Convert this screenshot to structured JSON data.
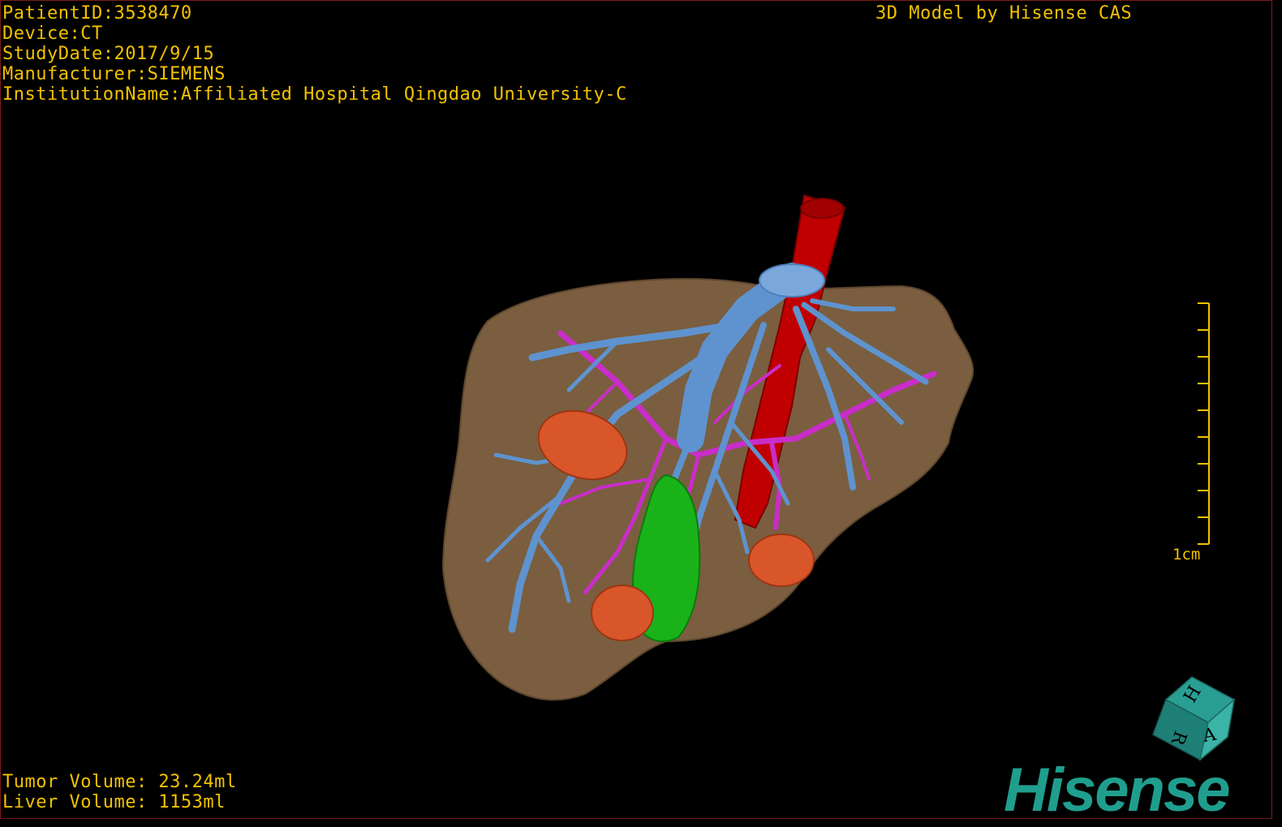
{
  "header": {
    "patient_id": "PatientID:3538470",
    "device": "Device:CT",
    "study_date": "StudyDate:2017/9/15",
    "manufacturer": "Manufacturer:SIEMENS",
    "institution": "InstitutionName:Affiliated Hospital Qingdao University-C",
    "model_credit": "3D Model by Hisense CAS"
  },
  "volumes": {
    "tumor": "Tumor Volume: 23.24ml",
    "liver": "Liver Volume: 1153ml"
  },
  "scale_bar": {
    "label": "1cm"
  },
  "orientation_cube": {
    "faces": [
      "H",
      "R",
      "A"
    ],
    "icon": "orientation-cube-icon"
  },
  "logo": {
    "text": "Hisense"
  },
  "colors": {
    "overlay_text": "#f2c200",
    "liver": "#7a5e3f",
    "portal_vein": "#5e93cf",
    "hepatic_vein": "#c92dc9",
    "artery": "#c00000",
    "tumor": "#d9552a",
    "gallbladder": "#19b319",
    "logo": "#1f9e8e"
  }
}
